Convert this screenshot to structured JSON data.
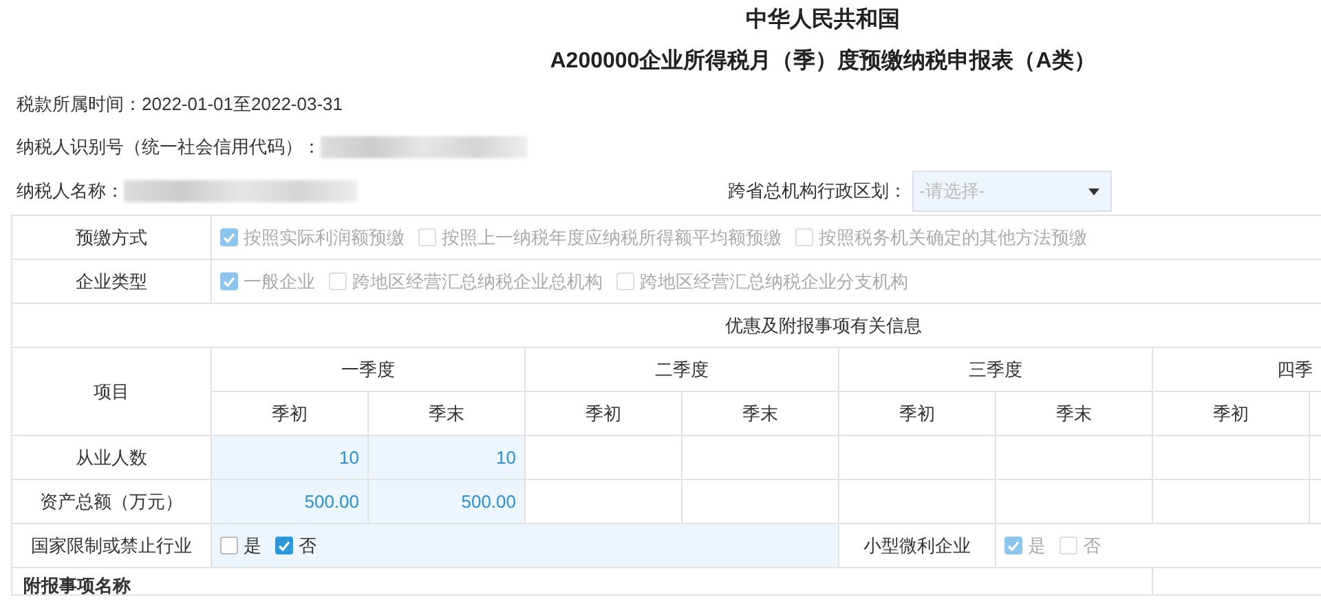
{
  "header": {
    "country": "中华人民共和国",
    "form_title": "A200000企业所得税月（季）度预缴纳税申报表（A类）"
  },
  "info": {
    "period_label": "税款所属时间：",
    "period_value": "2022-01-01至2022-03-31",
    "taxpayer_id_label": "纳税人识别号（统一社会信用代码）：",
    "taxpayer_name_label": "纳税人名称：",
    "region_label": "跨省总机构行政区划：",
    "region_select": {
      "placeholder": "-请选择-",
      "disabled": true
    }
  },
  "option_rows": [
    {
      "label": "预缴方式",
      "options": [
        {
          "label": "按照实际利润额预缴",
          "checked": true,
          "disabled": true
        },
        {
          "label": "按照上一纳税年度应纳税所得额平均额预缴",
          "checked": false,
          "disabled": true
        },
        {
          "label": "按照税务机关确定的其他方法预缴",
          "checked": false,
          "disabled": true
        }
      ]
    },
    {
      "label": "企业类型",
      "options": [
        {
          "label": "一般企业",
          "checked": true,
          "disabled": true
        },
        {
          "label": "跨地区经营汇总纳税企业总机构",
          "checked": false,
          "disabled": true
        },
        {
          "label": "跨地区经营汇总纳税企业分支机构",
          "checked": false,
          "disabled": true
        }
      ]
    }
  ],
  "section_title": "优惠及附报事项有关信息",
  "grid": {
    "item_header": "项目",
    "quarters": [
      "一季度",
      "二季度",
      "三季度",
      "四季"
    ],
    "sub_headers": [
      "季初",
      "季末",
      "季初",
      "季末",
      "季初",
      "季末",
      "季初"
    ],
    "rows": [
      {
        "label": "从业人数",
        "values": [
          "10",
          "10"
        ]
      },
      {
        "label": "资产总额（万元）",
        "values": [
          "500.00",
          "500.00"
        ]
      }
    ]
  },
  "restricted_industry": {
    "label": "国家限制或禁止行业",
    "options": [
      {
        "label": "是",
        "checked": false,
        "disabled": false
      },
      {
        "label": "否",
        "checked": true,
        "disabled": false
      }
    ]
  },
  "small_enterprise": {
    "label": "小型微利企业",
    "options": [
      {
        "label": "是",
        "checked": true,
        "disabled": true
      },
      {
        "label": "否",
        "checked": false,
        "disabled": true
      }
    ]
  },
  "attached_items_header": "附报事项名称"
}
